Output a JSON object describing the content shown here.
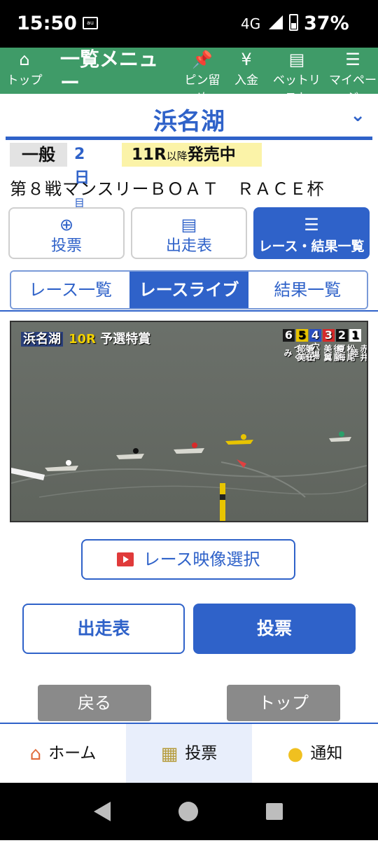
{
  "status": {
    "time": "15:50",
    "network": "4G",
    "battery": "37%",
    "sim_label": "au"
  },
  "topnav": {
    "top_label": "トップ",
    "menu_title": "一覧メニュー",
    "pin_label": "ピン留め",
    "deposit_label": "入金",
    "betlist_label": "ベットリスト",
    "mypage_label": "マイページ"
  },
  "venue": {
    "name": "浜名湖"
  },
  "info": {
    "grade": "一般",
    "day_num": "2日",
    "day_suffix": "目",
    "sale_race": "11R",
    "sale_after": "以降",
    "sale_status": "発売中"
  },
  "race_title": "第８戦マンスリーＢＯＡＴ　ＲＡＣＥ杯",
  "actions": {
    "vote": "投票",
    "program": "出走表",
    "results": "レース・結果一覧"
  },
  "tabs": [
    "レース一覧",
    "レースライブ",
    "結果一覧"
  ],
  "video": {
    "venue": "浜名湖",
    "race": "10R",
    "race_name": "予選特賞",
    "lanes": [
      {
        "num": "6",
        "name": "宮崎つぐみ",
        "color": "#1a1a1a"
      },
      {
        "num": "5",
        "name": "倉田郁美",
        "color": "#e8c400"
      },
      {
        "num": "4",
        "name": "穴場",
        "color": "#2a4fbf"
      },
      {
        "num": "3",
        "name": "後藤美翼",
        "color": "#d62a2a"
      },
      {
        "num": "2",
        "name": "松尾夏海",
        "color": "#111111"
      },
      {
        "num": "1",
        "name": "赤井睦",
        "color": "#ffffff"
      }
    ]
  },
  "video_select": "レース映像選択",
  "buttons": {
    "program": "出走表",
    "vote": "投票",
    "back": "戻る",
    "top": "トップ"
  },
  "bottom": {
    "home": "ホーム",
    "vote": "投票",
    "notify": "通知"
  },
  "colors": {
    "brand_green": "#3f9b68",
    "brand_blue": "#2f62c9"
  }
}
